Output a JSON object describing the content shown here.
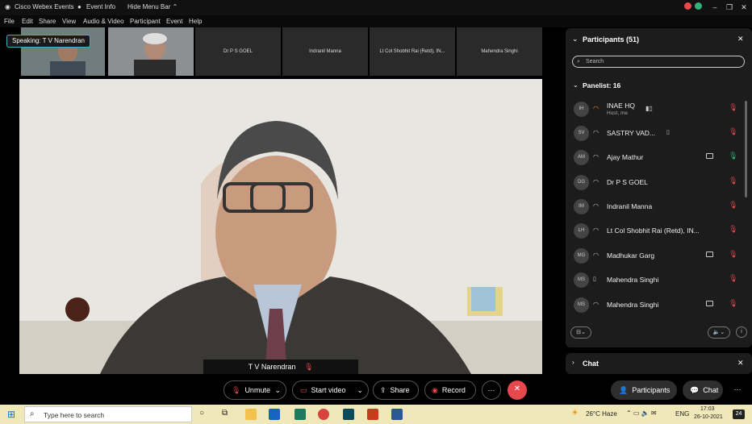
{
  "window": {
    "app_name": "Cisco Webex Events",
    "event_info": "Event Info",
    "hide_menu": "Hide Menu Bar"
  },
  "menu": [
    "File",
    "Edit",
    "Share",
    "View",
    "Audio & Video",
    "Participant",
    "Event",
    "Help"
  ],
  "speaking_label": "Speaking: T V Narendran",
  "thumbnails": [
    {
      "label": ""
    },
    {
      "label": ""
    },
    {
      "label": "Dr P S GOEL"
    },
    {
      "label": "Indranil Manna"
    },
    {
      "label": "Lt Col Shobhit Rai (Retd), IN..."
    },
    {
      "label": "Mahendra Singhi"
    }
  ],
  "main_video": {
    "name": "T V Narendran"
  },
  "participants_panel": {
    "title": "Participants (51)",
    "search_placeholder": "Search",
    "panelist_header": "Panelist: 16",
    "participants": [
      {
        "initials": "IH",
        "name": "INAE HQ",
        "sub": "Host, me",
        "mic": "muted",
        "video": false
      },
      {
        "initials": "SV",
        "name": "SASTRY VAD...",
        "sub": "",
        "mic": "muted",
        "video": false
      },
      {
        "initials": "AM",
        "name": "Ajay Mathur",
        "sub": "",
        "mic": "on",
        "video": true
      },
      {
        "initials": "DG",
        "name": "Dr P S GOEL",
        "sub": "",
        "mic": "muted",
        "video": false
      },
      {
        "initials": "IM",
        "name": "Indranil Manna",
        "sub": "",
        "mic": "muted",
        "video": false
      },
      {
        "initials": "LH",
        "name": "Lt Col Shobhit Rai (Retd), IN...",
        "sub": "",
        "mic": "muted",
        "video": false
      },
      {
        "initials": "MG",
        "name": "Madhukar Garg",
        "sub": "",
        "mic": "muted",
        "video": true
      },
      {
        "initials": "MS",
        "name": "Mahendra Singhi",
        "sub": "",
        "mic": "muted",
        "video": false
      },
      {
        "initials": "MS",
        "name": "Mahendra Singhi",
        "sub": "",
        "mic": "muted",
        "video": true
      }
    ]
  },
  "chat_panel": {
    "title": "Chat"
  },
  "controls": {
    "unmute": "Unmute",
    "start_video": "Start video",
    "share": "Share",
    "record": "Record",
    "more": "···",
    "participants": "Participants",
    "chat": "Chat"
  },
  "taskbar": {
    "search_placeholder": "Type here to search",
    "weather": "26°C Haze",
    "lang": "ENG",
    "time": "17:03",
    "date": "26-10-2021",
    "badge": "24"
  },
  "colors": {
    "accent": "#38b1c7",
    "muted": "#e5484d",
    "leave": "#e5484d",
    "live": "#2fb37a"
  }
}
